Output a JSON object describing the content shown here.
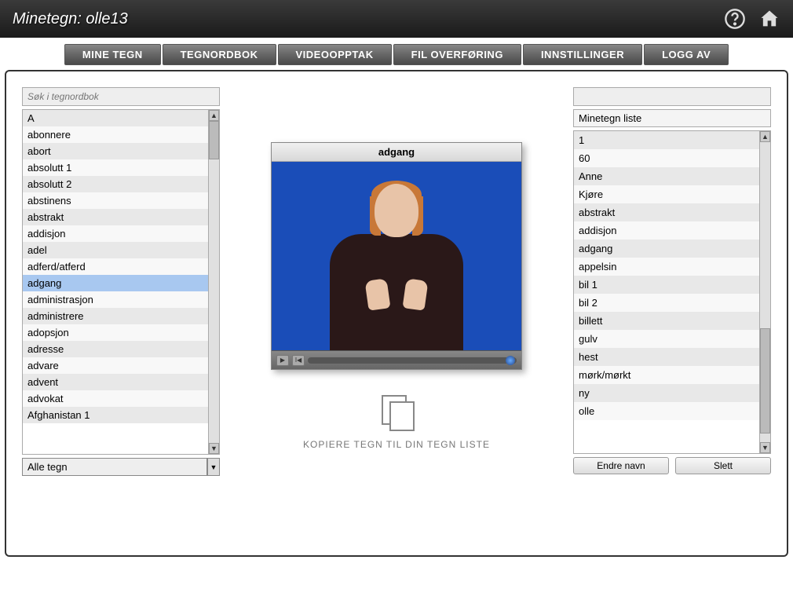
{
  "header": {
    "title": "Minetegn: olle13"
  },
  "nav": {
    "tabs": [
      "MINE TEGN",
      "TEGNORDBOK",
      "VIDEOOPPTAK",
      "FIL OVERFØRING",
      "INNSTILLINGER",
      "LOGG AV"
    ]
  },
  "left": {
    "search_placeholder": "Søk i tegnordbok",
    "words": [
      "A",
      "abonnere",
      "abort",
      "absolutt 1",
      "absolutt 2",
      "abstinens",
      "abstrakt",
      "addisjon",
      "adel",
      "adferd/atferd",
      "adgang",
      "administrasjon",
      "administrere",
      "adopsjon",
      "adresse",
      "advare",
      "advent",
      "advokat",
      "Afghanistan 1"
    ],
    "selected_word": "adgang",
    "filter": "Alle tegn"
  },
  "center": {
    "video_title": "adgang",
    "copy_label": "KOPIERE TEGN TIL DIN TEGN LISTE"
  },
  "right": {
    "header": "Minetegn liste",
    "items": [
      "1",
      "60",
      "Anne",
      "Kjøre",
      "abstrakt",
      "addisjon",
      "adgang",
      "appelsin",
      "bil 1",
      "bil 2",
      "billett",
      "gulv",
      "hest",
      "mørk/mørkt",
      "ny",
      "olle"
    ],
    "rename_label": "Endre navn",
    "delete_label": "Slett"
  }
}
